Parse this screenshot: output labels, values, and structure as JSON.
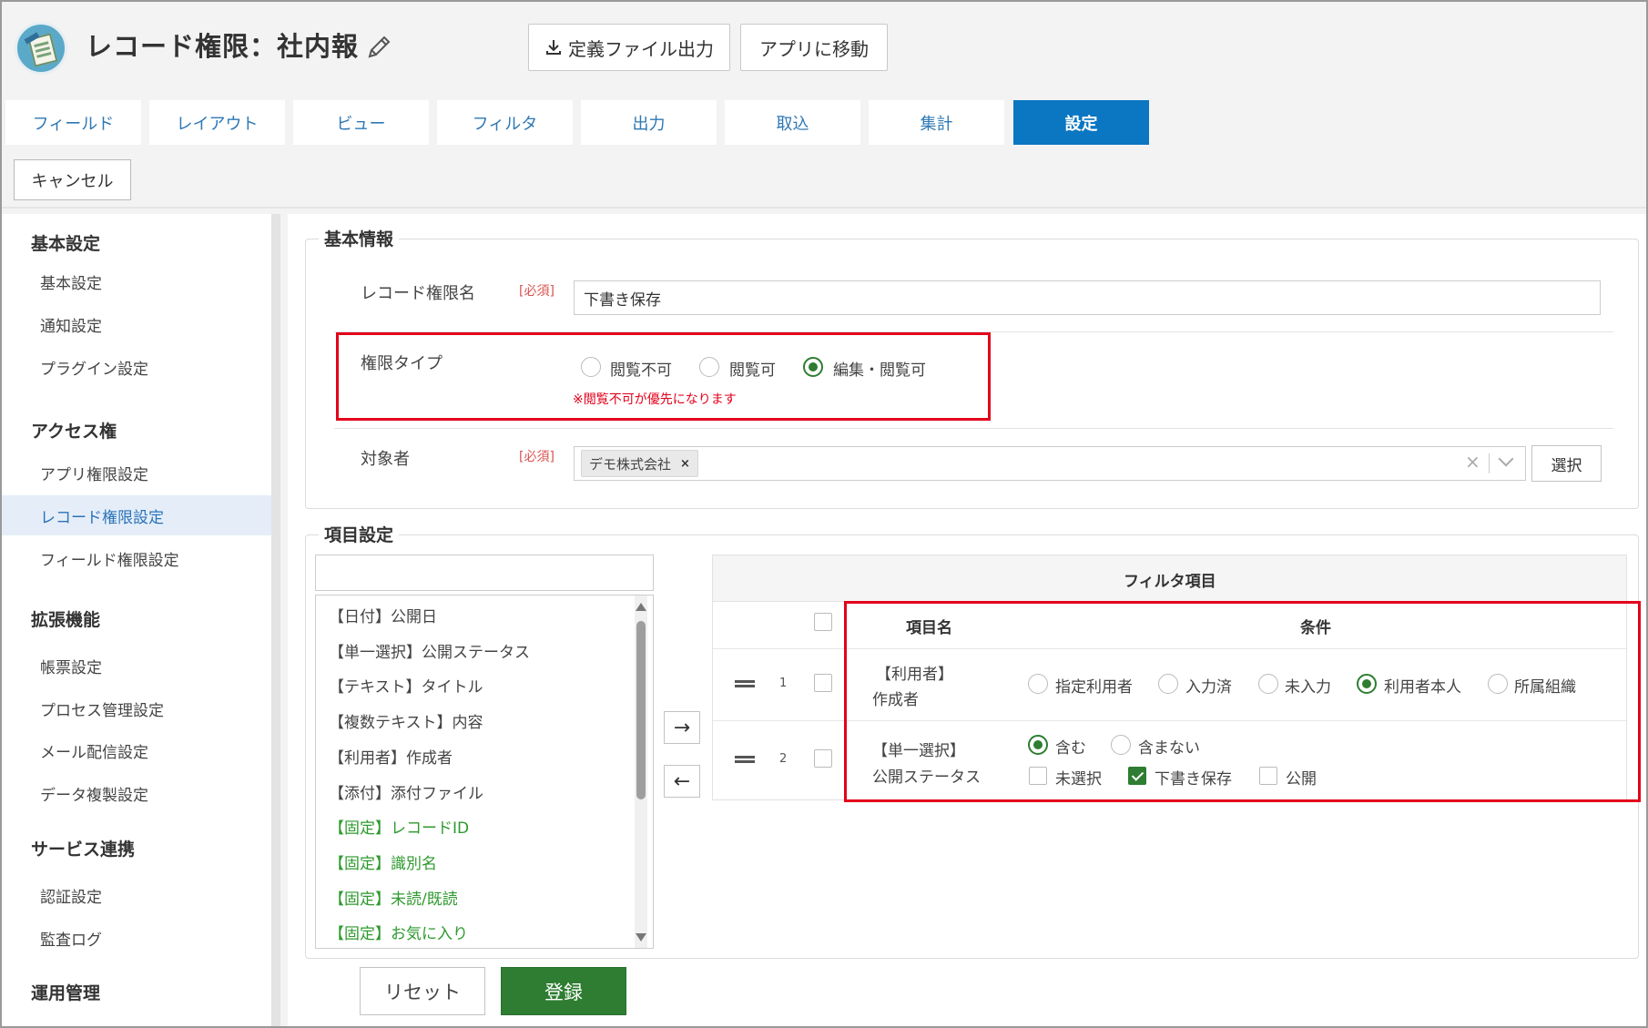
{
  "header": {
    "title": "レコード権限：社内報",
    "export_label": "定義ファイル出力",
    "move_label": "アプリに移動"
  },
  "tabs": [
    {
      "label": "フィールド"
    },
    {
      "label": "レイアウト"
    },
    {
      "label": "ビュー"
    },
    {
      "label": "フィルタ"
    },
    {
      "label": "出力"
    },
    {
      "label": "取込"
    },
    {
      "label": "集計"
    },
    {
      "label": "設定",
      "active": true
    }
  ],
  "toolbar": {
    "cancel_label": "キャンセル"
  },
  "sidebar": {
    "groups": [
      {
        "title": "基本設定",
        "items": [
          "基本設定",
          "通知設定",
          "プラグイン設定"
        ]
      },
      {
        "title": "アクセス権",
        "items": [
          "アプリ権限設定",
          "レコード権限設定",
          "フィールド権限設定"
        ]
      },
      {
        "title": "拡張機能",
        "items": [
          "帳票設定",
          "プロセス管理設定",
          "メール配信設定",
          "データ複製設定"
        ]
      },
      {
        "title": "サービス連携",
        "items": [
          "認証設定",
          "監査ログ"
        ]
      },
      {
        "title": "運用管理",
        "items": []
      }
    ],
    "active_item": "レコード権限設定"
  },
  "basic": {
    "legend": "基本情報",
    "name_label": "レコード権限名",
    "required": "[必須]",
    "name_value": "下書き保存",
    "type_label": "権限タイプ",
    "type_options": [
      "閲覧不可",
      "閲覧可",
      "編集・閲覧可"
    ],
    "type_selected": "編集・閲覧可",
    "type_note": "※閲覧不可が優先になります",
    "target_label": "対象者",
    "target_chip": "デモ株式会社",
    "chip_remove": "×",
    "clear_glyph": "×",
    "select_label": "選択"
  },
  "items": {
    "legend": "項目設定",
    "search_value": "",
    "list": [
      {
        "label": "【日付】公開日",
        "fixed": false
      },
      {
        "label": "【単一選択】公開ステータス",
        "fixed": false
      },
      {
        "label": "【テキスト】タイトル",
        "fixed": false
      },
      {
        "label": "【複数テキスト】内容",
        "fixed": false
      },
      {
        "label": "【利用者】作成者",
        "fixed": false
      },
      {
        "label": "【添付】添付ファイル",
        "fixed": false
      },
      {
        "label": "【固定】レコードID",
        "fixed": true
      },
      {
        "label": "【固定】識別名",
        "fixed": true
      },
      {
        "label": "【固定】未読/既読",
        "fixed": true
      },
      {
        "label": "【固定】お気に入り",
        "fixed": true
      }
    ],
    "add_arrow": "→",
    "remove_arrow": "←"
  },
  "filter": {
    "title": "フィルタ項目",
    "col_name": "項目名",
    "col_condition": "条件",
    "rows": [
      {
        "num": "1",
        "type": "【利用者】",
        "field": "作成者",
        "options": [
          "指定利用者",
          "入力済",
          "未入力",
          "利用者本人",
          "所属組織"
        ],
        "selected": "利用者本人"
      },
      {
        "num": "2",
        "type": "【単一選択】",
        "field": "公開ステータス",
        "match_options": [
          "含む",
          "含まない"
        ],
        "match_selected": "含む",
        "values": [
          {
            "label": "未選択",
            "checked": false
          },
          {
            "label": "下書き保存",
            "checked": true
          },
          {
            "label": "公開",
            "checked": false
          }
        ]
      }
    ]
  },
  "footer": {
    "reset_label": "リセット",
    "submit_label": "登録"
  },
  "colors": {
    "accent": "#0b76c1",
    "success": "#2e7d32",
    "highlight": "#e3001b",
    "fixed_item": "#2e9a2e"
  }
}
